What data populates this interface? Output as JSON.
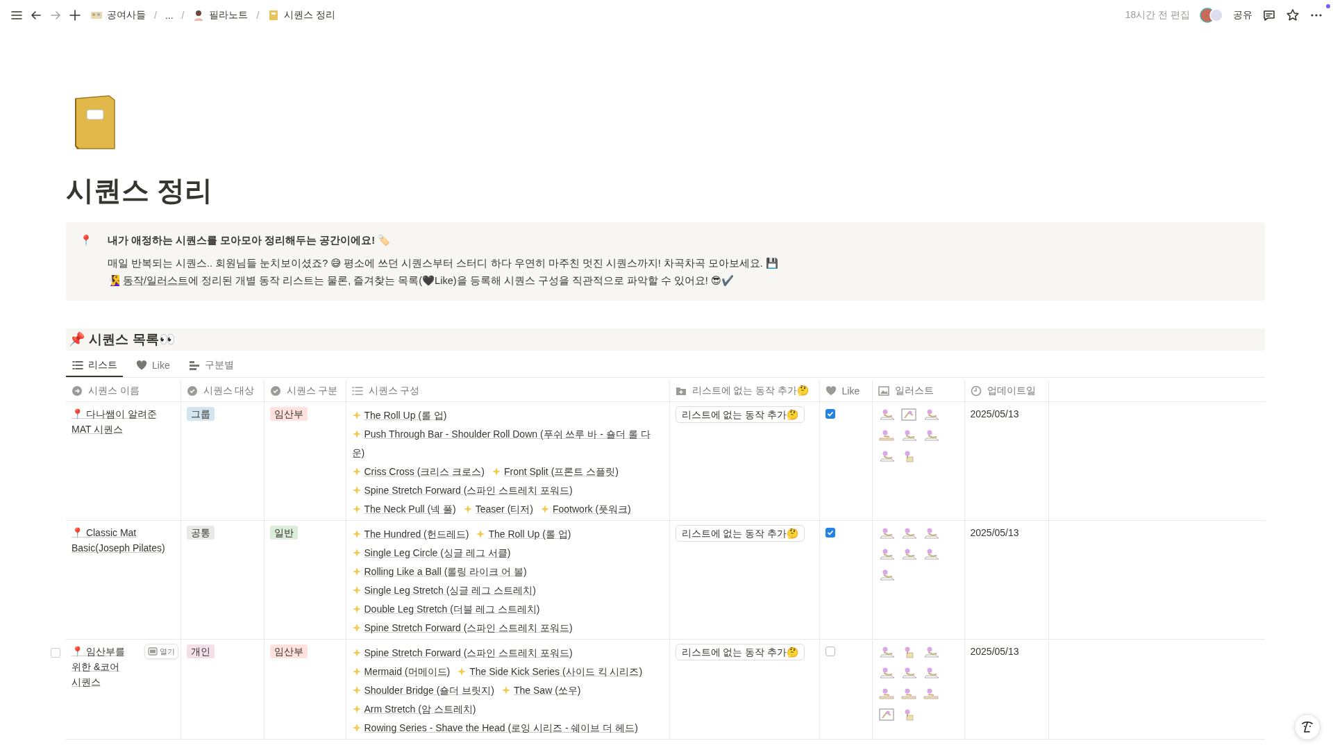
{
  "topbar": {
    "breadcrumb": [
      {
        "kind": "link",
        "text": "공여사들"
      },
      {
        "kind": "separator",
        "text": "/"
      },
      {
        "kind": "link",
        "text": "..."
      },
      {
        "kind": "separator",
        "text": "/"
      },
      {
        "kind": "link",
        "text": "필라노트"
      },
      {
        "kind": "separator",
        "text": "/"
      },
      {
        "kind": "link",
        "text": "시퀀스 정리"
      }
    ],
    "edited": "18시간 전 편집",
    "share": "공유"
  },
  "page": {
    "title": "시퀀스 정리"
  },
  "callout": {
    "icon": "📍",
    "heading": "내가 애정하는 시퀀스를 모아모아 정리해두는 공간이에요! 🏷️",
    "line1": "매일 반복되는 시퀀스.. 회원님들 눈치보이셨죠? 😅 평소에 쓰던 시퀀스부터 스터디 하다 우연히 마주친 멋진 시퀀스까지! 차곡차곡 모아보세요. 💾",
    "line2_prefix": "🧏‍♀️ ",
    "line2_link": "동작/일러스트",
    "line2_rest": "에 정리된 개별 동작 리스트는 물론, 즐겨찾는 목록(🖤Like)을 등록해 시퀀스 구성을 직관적으로 파악할 수 있어요! 😎✔️"
  },
  "database": {
    "title": "📌 시퀀스 목록👀",
    "tabs": [
      {
        "label": "리스트",
        "selected": true
      },
      {
        "label": "Like",
        "selected": false
      },
      {
        "label": "구분별",
        "selected": false
      }
    ],
    "columns": [
      {
        "label": "시퀀스 이름",
        "kind": "title"
      },
      {
        "label": "시퀀스 대상",
        "kind": "select"
      },
      {
        "label": "시퀀스 구분",
        "kind": "select"
      },
      {
        "label": "시퀀스 구성",
        "kind": "relation"
      },
      {
        "label": "리스트에 없는 동작 추가🤔",
        "kind": "button"
      },
      {
        "label": "Like",
        "kind": "checkbox"
      },
      {
        "label": "일러스트",
        "kind": "files"
      },
      {
        "label": "업데이트일",
        "kind": "date"
      }
    ],
    "rows": [
      {
        "hovered": false,
        "name": "📍 다나쌤이 알려준 MAT 시퀀스",
        "target": {
          "label": "그룹",
          "color": "#d3e5ef"
        },
        "category": {
          "label": "임산부",
          "color": "#ffe2dd"
        },
        "move_lines": [
          [
            "The Roll Up (롤 업)"
          ],
          [
            "Push Through Bar - Shoulder Roll Down (푸쉬 쓰루 바 - 숄더 롤 다운)"
          ],
          [
            "Criss Cross (크리스 크로스)",
            "Front Split (프론트 스플릿)"
          ],
          [
            "Spine Stretch Forward (스파인 스트레치 포워드)"
          ],
          [
            "The Neck Pull (넥 풀)",
            "Teaser (티저)",
            "Footwork (풋워크)"
          ]
        ],
        "button": "리스트에 없는 동작 추가🤔",
        "like": true,
        "illustrations": [
          {
            "kind": "mat"
          },
          {
            "kind": "frame"
          },
          {
            "kind": "mat"
          },
          {
            "kind": "reformer"
          },
          {
            "kind": "mat"
          },
          {
            "kind": "mat"
          },
          {
            "kind": "mat"
          },
          {
            "kind": "chair"
          }
        ],
        "updated": "2025/05/13"
      },
      {
        "hovered": false,
        "name": "📍 Classic Mat Basic(Joseph Pilates)",
        "target": {
          "label": "공통",
          "color": "#e9e9e7"
        },
        "category": {
          "label": "일반",
          "color": "#dbeddb"
        },
        "move_lines": [
          [
            "The Hundred (헌드레드)",
            "The Roll Up (롤 업)"
          ],
          [
            "Single Leg Circle (싱글 레그 서클)"
          ],
          [
            "Rolling Like a Ball (롤링 라이크 어 볼)"
          ],
          [
            "Single Leg Stretch (싱글 레그 스트레치)"
          ],
          [
            "Double Leg Stretch (더블 레그 스트레치)"
          ],
          [
            "Spine Stretch Forward (스파인 스트레치 포워드)"
          ]
        ],
        "button": "리스트에 없는 동작 추가🤔",
        "like": true,
        "illustrations": [
          {
            "kind": "mat"
          },
          {
            "kind": "mat"
          },
          {
            "kind": "mat"
          },
          {
            "kind": "mat"
          },
          {
            "kind": "mat"
          },
          {
            "kind": "mat"
          },
          {
            "kind": "mat"
          }
        ],
        "updated": "2025/05/13"
      },
      {
        "hovered": true,
        "open_label": "열기",
        "name": "📍 임산부를 위한 &코어 시퀀스",
        "target": {
          "label": "개인",
          "color": "#f5e0e9"
        },
        "category": {
          "label": "임산부",
          "color": "#ffe2dd"
        },
        "move_lines": [
          [
            "Spine Stretch Forward (스파인 스트레치 포워드)"
          ],
          [
            "Mermaid (머메이드)",
            "The Side Kick Series (사이드 킥 시리즈)"
          ],
          [
            "Shoulder Bridge (숄더 브릿지)",
            "The Saw (쏘우)"
          ],
          [
            "Arm Stretch (암 스트레치)"
          ],
          [
            "Rowing Series - Shave the Head (로잉 시리즈 - 쉐이브 더 헤드)"
          ]
        ],
        "button": "리스트에 없는 동작 추가🤔",
        "like": false,
        "illustrations": [
          {
            "kind": "mat"
          },
          {
            "kind": "chair"
          },
          {
            "kind": "mat"
          },
          {
            "kind": "mat"
          },
          {
            "kind": "mat"
          },
          {
            "kind": "mat"
          },
          {
            "kind": "reformer"
          },
          {
            "kind": "reformer"
          },
          {
            "kind": "reformer"
          },
          {
            "kind": "frame"
          },
          {
            "kind": "chair"
          }
        ],
        "updated": "2025/05/13"
      }
    ]
  }
}
